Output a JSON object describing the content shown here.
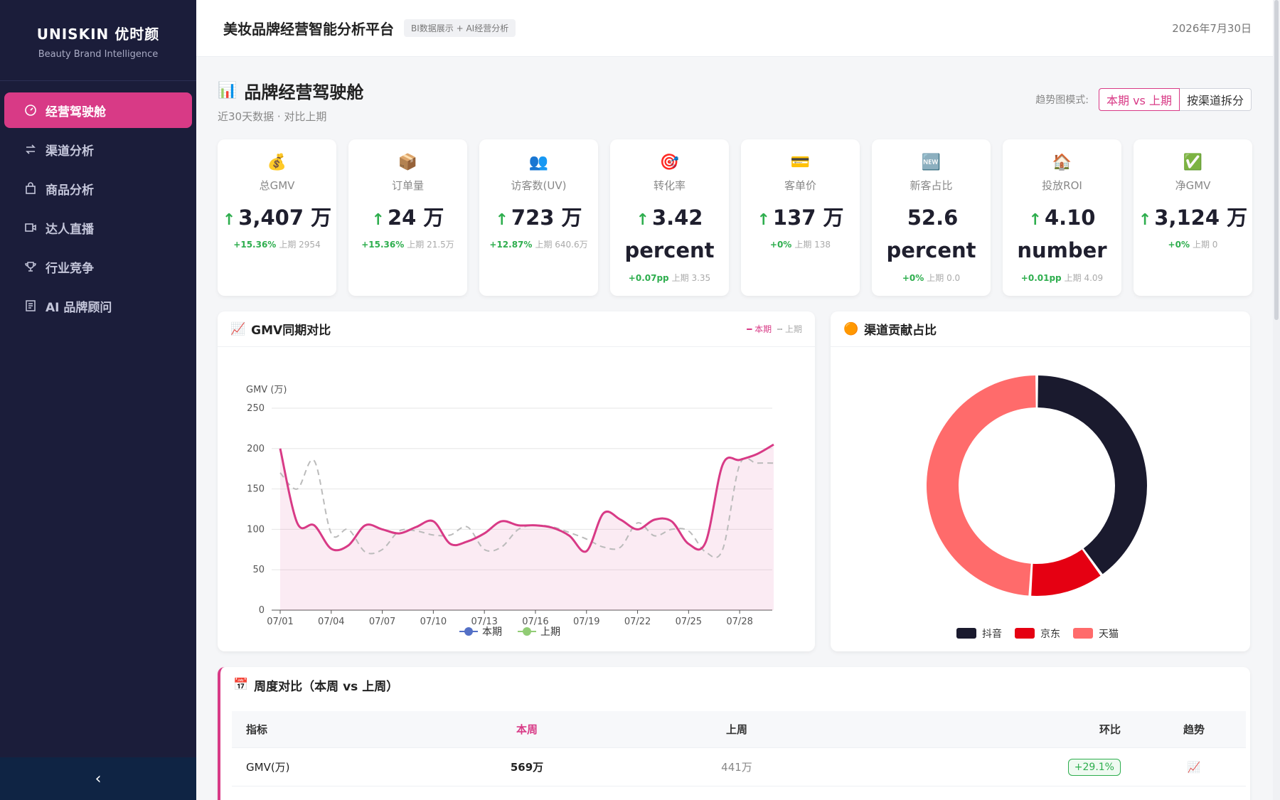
{
  "sidebar": {
    "brand": "UNISKIN 优时颜",
    "brand_sub": "Beauty Brand Intelligence",
    "items": [
      {
        "label": "经营驾驶舱",
        "icon": "dashboard-icon",
        "active": true
      },
      {
        "label": "渠道分析",
        "icon": "swap-icon",
        "active": false
      },
      {
        "label": "商品分析",
        "icon": "bag-icon",
        "active": false
      },
      {
        "label": "达人直播",
        "icon": "video-icon",
        "active": false
      },
      {
        "label": "行业竞争",
        "icon": "trophy-icon",
        "active": false
      },
      {
        "label": "AI 品牌顾问",
        "icon": "robot-icon",
        "active": false
      }
    ],
    "collapse_icon": "‹"
  },
  "topbar": {
    "title": "美妆品牌经营智能分析平台",
    "tag": "BI数据展示 + AI经营分析",
    "date": "2026年7月30日"
  },
  "page": {
    "icon": "📊",
    "title": "品牌经营驾驶舱",
    "subtitle": "近30天数据 · 对比上期",
    "mode_label": "趋势图模式:",
    "mode_options": [
      "本期 vs 上期",
      "按渠道拆分"
    ]
  },
  "kpis": [
    {
      "icon": "💰",
      "label": "总GMV",
      "arrow": "↑",
      "value": "3,407 万",
      "change": "+15.36%",
      "prev": "上期 2954"
    },
    {
      "icon": "📦",
      "label": "订单量",
      "arrow": "↑",
      "value": "24 万",
      "change": "+15.36%",
      "prev": "上期 21.5万"
    },
    {
      "icon": "👥",
      "label": "访客数(UV)",
      "arrow": "↑",
      "value": "723 万",
      "change": "+12.87%",
      "prev": "上期 640.6万"
    },
    {
      "icon": "🎯",
      "label": "转化率",
      "arrow": "↑",
      "value": "3.42 percent",
      "change": "+0.07pp",
      "prev": "上期 3.35"
    },
    {
      "icon": "💳",
      "label": "客单价",
      "arrow": "↑",
      "value": "137 万",
      "change": "+0%",
      "prev": "上期 138"
    },
    {
      "icon": "🆕",
      "label": "新客占比",
      "arrow": "",
      "value": "52.6 percent",
      "change": "+0%",
      "prev": "上期 0.0"
    },
    {
      "icon": "🏠",
      "label": "投放ROI",
      "arrow": "↑",
      "value": "4.10 number",
      "change": "+0.01pp",
      "prev": "上期 4.09"
    },
    {
      "icon": "✅",
      "label": "净GMV",
      "arrow": "↑",
      "value": "3,124 万",
      "change": "+0%",
      "prev": "上期 0"
    }
  ],
  "gmv_panel": {
    "icon": "📈",
    "title": "GMV同期对比",
    "legend_current": "━ 本期",
    "legend_prev": "┅ 上期"
  },
  "channel_panel": {
    "icon": "🟠",
    "title": "渠道贡献占比"
  },
  "week_panel": {
    "icon": "📅",
    "title": "周度对比（本周 vs 上周）",
    "headers": [
      "指标",
      "本周",
      "上周",
      "环比",
      "趋势"
    ],
    "rows": [
      {
        "metric": "GMV(万)",
        "this_week": "569万",
        "last_week": "441万",
        "change": "+29.1%",
        "trend_icon": "📈"
      }
    ]
  },
  "chart_data": [
    {
      "type": "line",
      "ylabel": "GMV (万)",
      "ylim": [
        0,
        250
      ],
      "yticks": [
        0,
        50,
        100,
        150,
        200,
        250
      ],
      "xtick_labels": [
        "07/01",
        "07/04",
        "07/07",
        "07/10",
        "07/13",
        "07/16",
        "07/19",
        "07/22",
        "07/25",
        "07/28"
      ],
      "x": [
        "07/01",
        "07/02",
        "07/03",
        "07/04",
        "07/05",
        "07/06",
        "07/07",
        "07/08",
        "07/09",
        "07/10",
        "07/11",
        "07/12",
        "07/13",
        "07/14",
        "07/15",
        "07/16",
        "07/17",
        "07/18",
        "07/19",
        "07/20",
        "07/21",
        "07/22",
        "07/23",
        "07/24",
        "07/25",
        "07/26",
        "07/27",
        "07/28",
        "07/29",
        "07/30"
      ],
      "series": [
        {
          "name": "本期",
          "color": "#d83a86",
          "style": "solid",
          "area": true,
          "values": [
            200,
            108,
            105,
            76,
            80,
            105,
            100,
            95,
            103,
            110,
            82,
            85,
            95,
            110,
            105,
            105,
            102,
            92,
            73,
            120,
            112,
            100,
            112,
            110,
            82,
            84,
            180,
            186,
            193,
            205
          ]
        },
        {
          "name": "上期",
          "color": "#bbbbbb",
          "style": "dashed",
          "area": false,
          "values": [
            170,
            150,
            185,
            95,
            100,
            72,
            75,
            98,
            98,
            93,
            93,
            103,
            75,
            78,
            100,
            105,
            103,
            96,
            88,
            78,
            78,
            108,
            92,
            100,
            98,
            72,
            75,
            180,
            182,
            182
          ]
        }
      ],
      "legend": [
        "本期",
        "上期"
      ],
      "legend_colors": [
        "#5470c6",
        "#91cc75"
      ],
      "legend_position": "bottom"
    },
    {
      "type": "pie",
      "donut": true,
      "labels": [
        "抖音",
        "京东",
        "天猫"
      ],
      "values": [
        40,
        11,
        49
      ],
      "colors": [
        "#1a1a2e",
        "#e50012",
        "#ff6b6b"
      ],
      "legend_position": "bottom"
    }
  ]
}
